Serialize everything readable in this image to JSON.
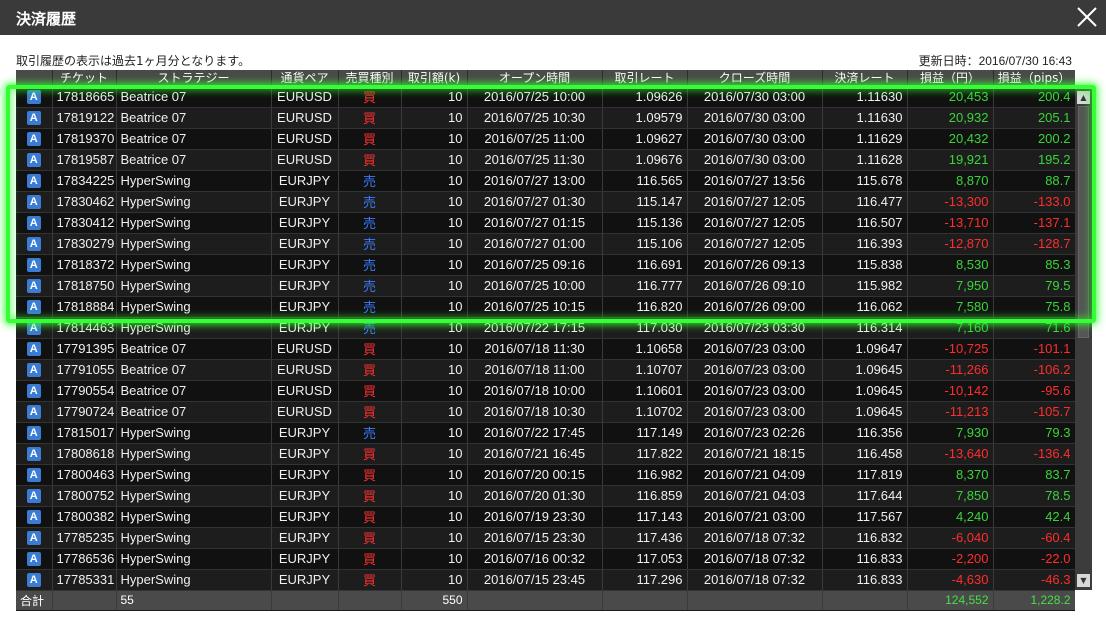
{
  "window": {
    "title": "決済履歴"
  },
  "notice": "取引履歴の表示は過去1ヶ月分となります。",
  "updated": "更新日時：2016/07/30 16:43",
  "columns": [
    "",
    "チケット",
    "ストラテジー",
    "通貨ペア",
    "売買種別",
    "取引額(k)",
    "オープン時間",
    "取引レート",
    "クローズ時間",
    "決済レート",
    "損益（円）",
    "損益（pips）"
  ],
  "rows": [
    {
      "ticket": "17818665",
      "strategy": "Beatrice 07",
      "pair": "EURUSD",
      "side": "買",
      "amount": "10",
      "open": "2016/07/25 10:00",
      "open_rate": "1.09626",
      "close": "2016/07/30 03:00",
      "close_rate": "1.11630",
      "pl_yen": "20,453",
      "pl_pips": "200.4"
    },
    {
      "ticket": "17819122",
      "strategy": "Beatrice 07",
      "pair": "EURUSD",
      "side": "買",
      "amount": "10",
      "open": "2016/07/25 10:30",
      "open_rate": "1.09579",
      "close": "2016/07/30 03:00",
      "close_rate": "1.11630",
      "pl_yen": "20,932",
      "pl_pips": "205.1"
    },
    {
      "ticket": "17819370",
      "strategy": "Beatrice 07",
      "pair": "EURUSD",
      "side": "買",
      "amount": "10",
      "open": "2016/07/25 11:00",
      "open_rate": "1.09627",
      "close": "2016/07/30 03:00",
      "close_rate": "1.11629",
      "pl_yen": "20,432",
      "pl_pips": "200.2"
    },
    {
      "ticket": "17819587",
      "strategy": "Beatrice 07",
      "pair": "EURUSD",
      "side": "買",
      "amount": "10",
      "open": "2016/07/25 11:30",
      "open_rate": "1.09676",
      "close": "2016/07/30 03:00",
      "close_rate": "1.11628",
      "pl_yen": "19,921",
      "pl_pips": "195.2"
    },
    {
      "ticket": "17834225",
      "strategy": "HyperSwing",
      "pair": "EURJPY",
      "side": "売",
      "amount": "10",
      "open": "2016/07/27 13:00",
      "open_rate": "116.565",
      "close": "2016/07/27 13:56",
      "close_rate": "115.678",
      "pl_yen": "8,870",
      "pl_pips": "88.7"
    },
    {
      "ticket": "17830462",
      "strategy": "HyperSwing",
      "pair": "EURJPY",
      "side": "売",
      "amount": "10",
      "open": "2016/07/27 01:30",
      "open_rate": "115.147",
      "close": "2016/07/27 12:05",
      "close_rate": "116.477",
      "pl_yen": "-13,300",
      "pl_pips": "-133.0"
    },
    {
      "ticket": "17830412",
      "strategy": "HyperSwing",
      "pair": "EURJPY",
      "side": "売",
      "amount": "10",
      "open": "2016/07/27 01:15",
      "open_rate": "115.136",
      "close": "2016/07/27 12:05",
      "close_rate": "116.507",
      "pl_yen": "-13,710",
      "pl_pips": "-137.1"
    },
    {
      "ticket": "17830279",
      "strategy": "HyperSwing",
      "pair": "EURJPY",
      "side": "売",
      "amount": "10",
      "open": "2016/07/27 01:00",
      "open_rate": "115.106",
      "close": "2016/07/27 12:05",
      "close_rate": "116.393",
      "pl_yen": "-12,870",
      "pl_pips": "-128.7"
    },
    {
      "ticket": "17818372",
      "strategy": "HyperSwing",
      "pair": "EURJPY",
      "side": "売",
      "amount": "10",
      "open": "2016/07/25 09:16",
      "open_rate": "116.691",
      "close": "2016/07/26 09:13",
      "close_rate": "115.838",
      "pl_yen": "8,530",
      "pl_pips": "85.3"
    },
    {
      "ticket": "17818750",
      "strategy": "HyperSwing",
      "pair": "EURJPY",
      "side": "売",
      "amount": "10",
      "open": "2016/07/25 10:00",
      "open_rate": "116.777",
      "close": "2016/07/26 09:10",
      "close_rate": "115.982",
      "pl_yen": "7,950",
      "pl_pips": "79.5"
    },
    {
      "ticket": "17818884",
      "strategy": "HyperSwing",
      "pair": "EURJPY",
      "side": "売",
      "amount": "10",
      "open": "2016/07/25 10:15",
      "open_rate": "116.820",
      "close": "2016/07/26 09:00",
      "close_rate": "116.062",
      "pl_yen": "7,580",
      "pl_pips": "75.8"
    },
    {
      "ticket": "17814463",
      "strategy": "HyperSwing",
      "pair": "EURJPY",
      "side": "売",
      "amount": "10",
      "open": "2016/07/22 17:15",
      "open_rate": "117.030",
      "close": "2016/07/23 03:30",
      "close_rate": "116.314",
      "pl_yen": "7,160",
      "pl_pips": "71.6"
    },
    {
      "ticket": "17791395",
      "strategy": "Beatrice 07",
      "pair": "EURUSD",
      "side": "買",
      "amount": "10",
      "open": "2016/07/18 11:30",
      "open_rate": "1.10658",
      "close": "2016/07/23 03:00",
      "close_rate": "1.09647",
      "pl_yen": "-10,725",
      "pl_pips": "-101.1"
    },
    {
      "ticket": "17791055",
      "strategy": "Beatrice 07",
      "pair": "EURUSD",
      "side": "買",
      "amount": "10",
      "open": "2016/07/18 11:00",
      "open_rate": "1.10707",
      "close": "2016/07/23 03:00",
      "close_rate": "1.09645",
      "pl_yen": "-11,266",
      "pl_pips": "-106.2"
    },
    {
      "ticket": "17790554",
      "strategy": "Beatrice 07",
      "pair": "EURUSD",
      "side": "買",
      "amount": "10",
      "open": "2016/07/18 10:00",
      "open_rate": "1.10601",
      "close": "2016/07/23 03:00",
      "close_rate": "1.09645",
      "pl_yen": "-10,142",
      "pl_pips": "-95.6"
    },
    {
      "ticket": "17790724",
      "strategy": "Beatrice 07",
      "pair": "EURUSD",
      "side": "買",
      "amount": "10",
      "open": "2016/07/18 10:30",
      "open_rate": "1.10702",
      "close": "2016/07/23 03:00",
      "close_rate": "1.09645",
      "pl_yen": "-11,213",
      "pl_pips": "-105.7"
    },
    {
      "ticket": "17815017",
      "strategy": "HyperSwing",
      "pair": "EURJPY",
      "side": "売",
      "amount": "10",
      "open": "2016/07/22 17:45",
      "open_rate": "117.149",
      "close": "2016/07/23 02:26",
      "close_rate": "116.356",
      "pl_yen": "7,930",
      "pl_pips": "79.3"
    },
    {
      "ticket": "17808618",
      "strategy": "HyperSwing",
      "pair": "EURJPY",
      "side": "買",
      "amount": "10",
      "open": "2016/07/21 16:45",
      "open_rate": "117.822",
      "close": "2016/07/21 18:15",
      "close_rate": "116.458",
      "pl_yen": "-13,640",
      "pl_pips": "-136.4"
    },
    {
      "ticket": "17800463",
      "strategy": "HyperSwing",
      "pair": "EURJPY",
      "side": "買",
      "amount": "10",
      "open": "2016/07/20 00:15",
      "open_rate": "116.982",
      "close": "2016/07/21 04:09",
      "close_rate": "117.819",
      "pl_yen": "8,370",
      "pl_pips": "83.7"
    },
    {
      "ticket": "17800752",
      "strategy": "HyperSwing",
      "pair": "EURJPY",
      "side": "買",
      "amount": "10",
      "open": "2016/07/20 01:30",
      "open_rate": "116.859",
      "close": "2016/07/21 04:03",
      "close_rate": "117.644",
      "pl_yen": "7,850",
      "pl_pips": "78.5"
    },
    {
      "ticket": "17800382",
      "strategy": "HyperSwing",
      "pair": "EURJPY",
      "side": "買",
      "amount": "10",
      "open": "2016/07/19 23:30",
      "open_rate": "117.143",
      "close": "2016/07/21 03:00",
      "close_rate": "117.567",
      "pl_yen": "4,240",
      "pl_pips": "42.4"
    },
    {
      "ticket": "17785235",
      "strategy": "HyperSwing",
      "pair": "EURJPY",
      "side": "買",
      "amount": "10",
      "open": "2016/07/15 23:30",
      "open_rate": "117.436",
      "close": "2016/07/18 07:32",
      "close_rate": "116.832",
      "pl_yen": "-6,040",
      "pl_pips": "-60.4"
    },
    {
      "ticket": "17786536",
      "strategy": "HyperSwing",
      "pair": "EURJPY",
      "side": "買",
      "amount": "10",
      "open": "2016/07/16 00:32",
      "open_rate": "117.053",
      "close": "2016/07/18 07:32",
      "close_rate": "116.833",
      "pl_yen": "-2,200",
      "pl_pips": "-22.0"
    },
    {
      "ticket": "17785331",
      "strategy": "HyperSwing",
      "pair": "EURJPY",
      "side": "買",
      "amount": "10",
      "open": "2016/07/15 23:45",
      "open_rate": "117.296",
      "close": "2016/07/18 07:32",
      "close_rate": "116.833",
      "pl_yen": "-4,630",
      "pl_pips": "-46.3"
    }
  ],
  "totals": {
    "label": "合計",
    "count": "55",
    "amount": "550",
    "pl_yen": "124,552",
    "pl_pips": "1,228.2"
  },
  "row_badge": "A",
  "colors": {
    "positive": "#3ad43a",
    "negative": "#ff2d2d",
    "buy": "#ff3030",
    "sell": "#3a7bff",
    "highlight": "#33ff33",
    "badge": "#3a7bd4"
  },
  "icons": {
    "close": "close-x-icon",
    "scroll_up": "arrow-up-icon",
    "scroll_down": "arrow-down-icon"
  }
}
